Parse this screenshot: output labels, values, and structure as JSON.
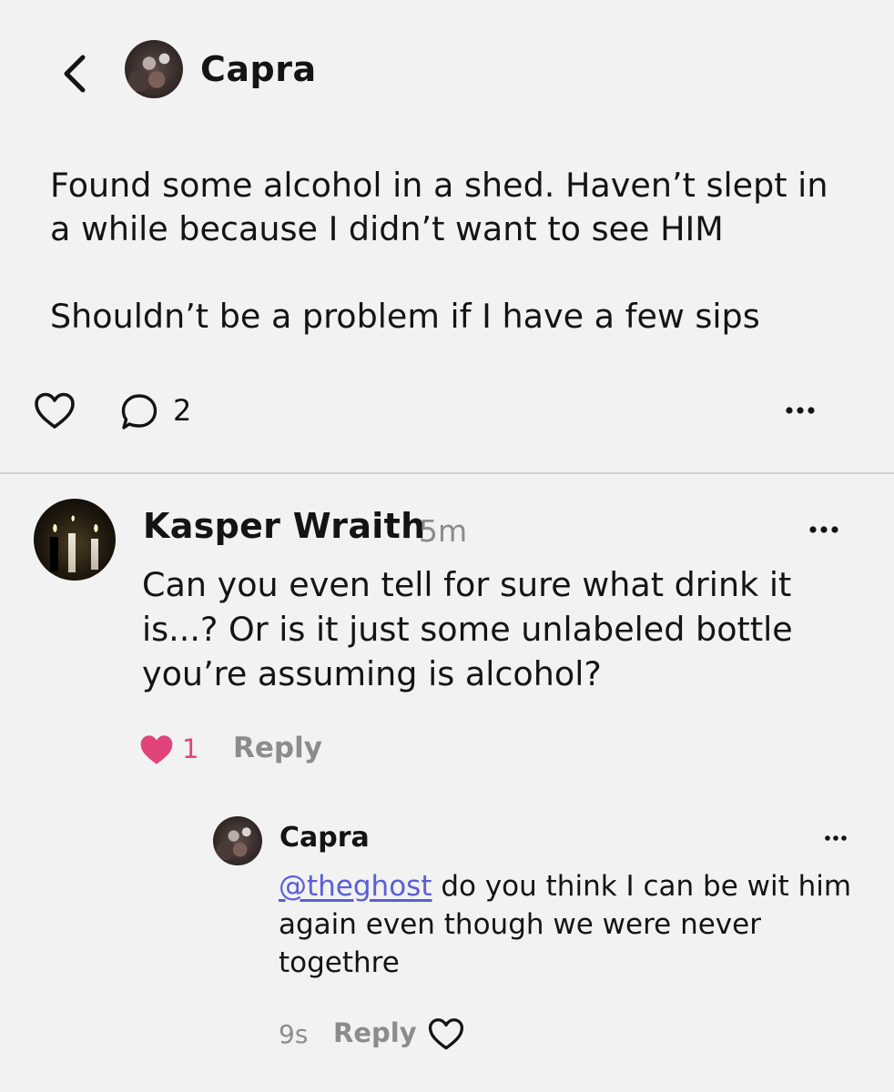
{
  "header": {
    "back_icon": "chevron-left-icon",
    "author_name": "Capra"
  },
  "post": {
    "body": "Found some alcohol in a shed. Haven’t slept in\na while because I didn’t want to see HIM\n\nShouldn’t be a problem if I have a few sips",
    "like_icon": "heart-outline-icon",
    "comment_icon": "comment-bubble-icon",
    "comment_count": "2",
    "more_icon": "ellipsis-icon"
  },
  "comments": [
    {
      "author": "Kasper Wraith",
      "time": "5m",
      "text": "Can you even tell for sure what drink it is...? Or is it just some unlabeled bottle you’re assuming is alcohol?",
      "like_count": "1",
      "liked": true,
      "reply_label": "Reply",
      "replies": [
        {
          "author": "Capra",
          "mention": "@theghost",
          "text": " do you think I can be wit him again even though we were never togethre",
          "time": "9s",
          "reply_label": "Reply",
          "liked": false
        }
      ]
    }
  ],
  "colors": {
    "background": "#f2f2f2",
    "text": "#141414",
    "muted": "#8c8c8c",
    "like_pink": "#e0447b",
    "mention_link": "#5b5ed6",
    "divider": "#d2d2d2"
  }
}
